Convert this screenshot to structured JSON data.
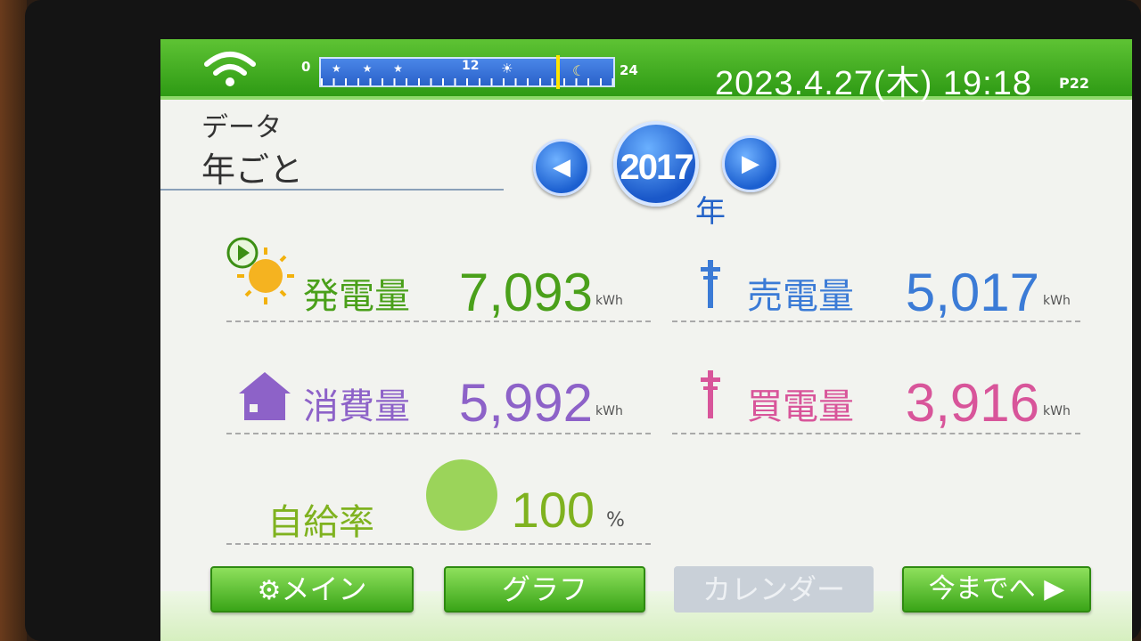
{
  "topbar": {
    "timeline": {
      "start": "0",
      "mid": "12",
      "end": "24"
    },
    "datetime": "2023.4.27(木) 19:18",
    "page": "P22"
  },
  "header": {
    "section": "データ",
    "mode": "年ごと"
  },
  "year": {
    "value": "2017",
    "unit": "年"
  },
  "stats": {
    "generation": {
      "label": "発電量",
      "value": "7,093",
      "unit": "kWh"
    },
    "sold": {
      "label": "売電量",
      "value": "5,017",
      "unit": "kWh"
    },
    "consumption": {
      "label": "消費量",
      "value": "5,992",
      "unit": "kWh"
    },
    "bought": {
      "label": "買電量",
      "value": "3,916",
      "unit": "kWh"
    },
    "self_sufficiency": {
      "label": "自給率",
      "value": "100",
      "unit": "%"
    }
  },
  "buttons": {
    "main": "メイン",
    "graph": "グラフ",
    "calendar": "カレンダー",
    "to_now": "今までへ ▶"
  },
  "colors": {
    "generation": "#4aa01a",
    "sold": "#3b7bd6",
    "consumption": "#8d62c8",
    "bought": "#d8559a",
    "bar": "#2e9a14"
  }
}
